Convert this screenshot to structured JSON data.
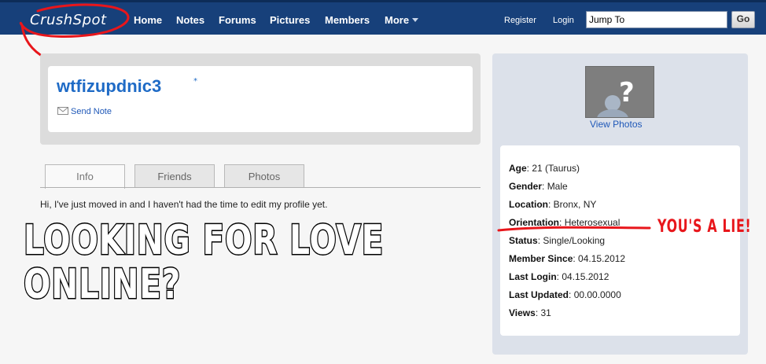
{
  "nav": {
    "logo": "CrushSpot",
    "items": [
      "Home",
      "Notes",
      "Forums",
      "Pictures",
      "Members",
      "More"
    ],
    "register": "Register",
    "login": "Login",
    "jump_value": "Jump To",
    "go_label": "Go"
  },
  "profile": {
    "username": "wtfizupdnic3",
    "asterisk": "*",
    "send_note": "Send Note"
  },
  "tabs": [
    "Info",
    "Friends",
    "Photos"
  ],
  "bio": "Hi, I've just moved in and I haven't had the time to edit my profile yet.",
  "meme": {
    "line1": "LOOKING FOR LOVE",
    "line2": "ONLINE?"
  },
  "sidebar": {
    "view_photos": "View Photos",
    "details": [
      {
        "label": "Age",
        "value": "21 (Taurus)"
      },
      {
        "label": "Gender",
        "value": "Male"
      },
      {
        "label": "Location",
        "value": "Bronx, NY"
      },
      {
        "label": "Orientation",
        "value": "Heterosexual"
      },
      {
        "label": "Status",
        "value": "Single/Looking"
      },
      {
        "label": "Member Since",
        "value": "04.15.2012"
      },
      {
        "label": "Last Login",
        "value": "04.15.2012"
      },
      {
        "label": "Last Updated",
        "value": "00.00.0000"
      },
      {
        "label": "Views",
        "value": "31"
      }
    ],
    "annotation": "YOU'S A LIE!"
  },
  "colors": {
    "nav_bg": "#17407a",
    "link_blue": "#1f6bc6",
    "annotation_red": "#e8161b"
  }
}
